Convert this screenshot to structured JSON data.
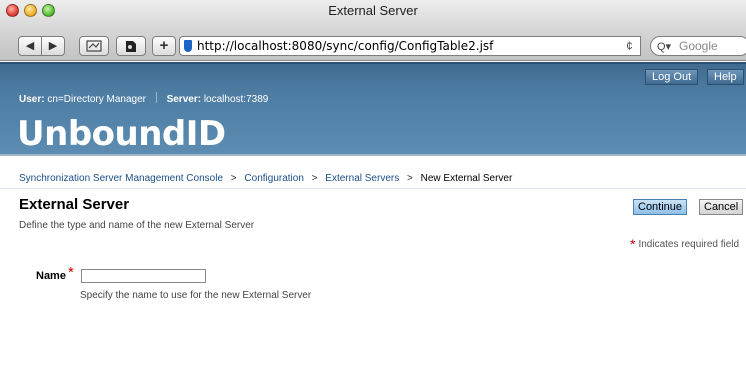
{
  "window": {
    "title": "External Server"
  },
  "toolbar": {
    "back_glyph": "◀",
    "forward_glyph": "▶",
    "add_glyph": "+",
    "url": "http://localhost:8080/sync/config/ConfigTable2.jsf",
    "reload_glyph": "¢",
    "search_placeholder": "Google",
    "search_glyph": "Q▾"
  },
  "header": {
    "logout_label": "Log Out",
    "help_label": "Help",
    "user_label": "User:",
    "user_value": "cn=Directory Manager",
    "server_label": "Server:",
    "server_value": "localhost:7389",
    "logo": "UnboundID",
    "background_color": "#4e7da4"
  },
  "breadcrumb": {
    "items": [
      "Synchronization Server Management Console",
      "Configuration",
      "External Servers"
    ],
    "current": "New External Server",
    "separator": ">"
  },
  "page": {
    "title": "External Server",
    "description": "Define the type and name of the new External Server",
    "continue_label": "Continue",
    "cancel_label": "Cancel",
    "required_star": "*",
    "required_note": "Indicates required field"
  },
  "form": {
    "name_label": "Name",
    "name_required_star": "*",
    "name_value": "",
    "name_help": "Specify the name to use for the new External Server"
  },
  "icons": {
    "back": "back-arrow-icon",
    "forward": "forward-arrow-icon",
    "snapback": "snapback-icon",
    "bookmarks": "bookmark-icon",
    "add": "add-icon",
    "site": "site-favicon-icon",
    "reload": "reload-icon",
    "search": "search-icon"
  }
}
